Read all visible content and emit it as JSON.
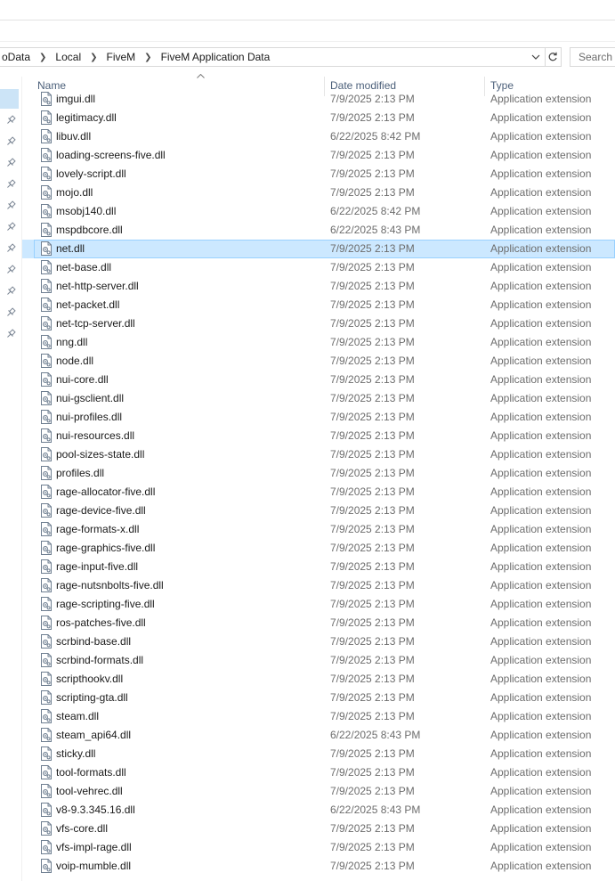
{
  "address": {
    "crumbs": [
      "oData",
      "Local",
      "FiveM",
      "FiveM Application Data"
    ],
    "search_placeholder": "Search F"
  },
  "columns": {
    "name": "Name",
    "date": "Date modified",
    "type": "Type"
  },
  "files": [
    {
      "name": "imgui.dll",
      "date": "7/9/2025 2:13 PM",
      "type": "Application extension"
    },
    {
      "name": "legitimacy.dll",
      "date": "7/9/2025 2:13 PM",
      "type": "Application extension"
    },
    {
      "name": "libuv.dll",
      "date": "6/22/2025 8:42 PM",
      "type": "Application extension"
    },
    {
      "name": "loading-screens-five.dll",
      "date": "7/9/2025 2:13 PM",
      "type": "Application extension"
    },
    {
      "name": "lovely-script.dll",
      "date": "7/9/2025 2:13 PM",
      "type": "Application extension"
    },
    {
      "name": "mojo.dll",
      "date": "7/9/2025 2:13 PM",
      "type": "Application extension"
    },
    {
      "name": "msobj140.dll",
      "date": "6/22/2025 8:42 PM",
      "type": "Application extension"
    },
    {
      "name": "mspdbcore.dll",
      "date": "6/22/2025 8:43 PM",
      "type": "Application extension"
    },
    {
      "name": "net.dll",
      "date": "7/9/2025 2:13 PM",
      "type": "Application extension",
      "selected": true
    },
    {
      "name": "net-base.dll",
      "date": "7/9/2025 2:13 PM",
      "type": "Application extension"
    },
    {
      "name": "net-http-server.dll",
      "date": "7/9/2025 2:13 PM",
      "type": "Application extension"
    },
    {
      "name": "net-packet.dll",
      "date": "7/9/2025 2:13 PM",
      "type": "Application extension"
    },
    {
      "name": "net-tcp-server.dll",
      "date": "7/9/2025 2:13 PM",
      "type": "Application extension"
    },
    {
      "name": "nng.dll",
      "date": "7/9/2025 2:13 PM",
      "type": "Application extension"
    },
    {
      "name": "node.dll",
      "date": "7/9/2025 2:13 PM",
      "type": "Application extension"
    },
    {
      "name": "nui-core.dll",
      "date": "7/9/2025 2:13 PM",
      "type": "Application extension"
    },
    {
      "name": "nui-gsclient.dll",
      "date": "7/9/2025 2:13 PM",
      "type": "Application extension"
    },
    {
      "name": "nui-profiles.dll",
      "date": "7/9/2025 2:13 PM",
      "type": "Application extension"
    },
    {
      "name": "nui-resources.dll",
      "date": "7/9/2025 2:13 PM",
      "type": "Application extension"
    },
    {
      "name": "pool-sizes-state.dll",
      "date": "7/9/2025 2:13 PM",
      "type": "Application extension"
    },
    {
      "name": "profiles.dll",
      "date": "7/9/2025 2:13 PM",
      "type": "Application extension"
    },
    {
      "name": "rage-allocator-five.dll",
      "date": "7/9/2025 2:13 PM",
      "type": "Application extension"
    },
    {
      "name": "rage-device-five.dll",
      "date": "7/9/2025 2:13 PM",
      "type": "Application extension"
    },
    {
      "name": "rage-formats-x.dll",
      "date": "7/9/2025 2:13 PM",
      "type": "Application extension"
    },
    {
      "name": "rage-graphics-five.dll",
      "date": "7/9/2025 2:13 PM",
      "type": "Application extension"
    },
    {
      "name": "rage-input-five.dll",
      "date": "7/9/2025 2:13 PM",
      "type": "Application extension"
    },
    {
      "name": "rage-nutsnbolts-five.dll",
      "date": "7/9/2025 2:13 PM",
      "type": "Application extension"
    },
    {
      "name": "rage-scripting-five.dll",
      "date": "7/9/2025 2:13 PM",
      "type": "Application extension"
    },
    {
      "name": "ros-patches-five.dll",
      "date": "7/9/2025 2:13 PM",
      "type": "Application extension"
    },
    {
      "name": "scrbind-base.dll",
      "date": "7/9/2025 2:13 PM",
      "type": "Application extension"
    },
    {
      "name": "scrbind-formats.dll",
      "date": "7/9/2025 2:13 PM",
      "type": "Application extension"
    },
    {
      "name": "scripthookv.dll",
      "date": "7/9/2025 2:13 PM",
      "type": "Application extension"
    },
    {
      "name": "scripting-gta.dll",
      "date": "7/9/2025 2:13 PM",
      "type": "Application extension"
    },
    {
      "name": "steam.dll",
      "date": "7/9/2025 2:13 PM",
      "type": "Application extension"
    },
    {
      "name": "steam_api64.dll",
      "date": "6/22/2025 8:43 PM",
      "type": "Application extension"
    },
    {
      "name": "sticky.dll",
      "date": "7/9/2025 2:13 PM",
      "type": "Application extension"
    },
    {
      "name": "tool-formats.dll",
      "date": "7/9/2025 2:13 PM",
      "type": "Application extension"
    },
    {
      "name": "tool-vehrec.dll",
      "date": "7/9/2025 2:13 PM",
      "type": "Application extension"
    },
    {
      "name": "v8-9.3.345.16.dll",
      "date": "6/22/2025 8:43 PM",
      "type": "Application extension"
    },
    {
      "name": "vfs-core.dll",
      "date": "7/9/2025 2:13 PM",
      "type": "Application extension"
    },
    {
      "name": "vfs-impl-rage.dll",
      "date": "7/9/2025 2:13 PM",
      "type": "Application extension"
    },
    {
      "name": "voip-mumble.dll",
      "date": "7/9/2025 2:13 PM",
      "type": "Application extension"
    }
  ],
  "colors": {
    "selection_bg": "#cce8ff",
    "selection_border": "#99d1ff",
    "header_text": "#4c607a",
    "secondary_text": "#6d6d6d"
  },
  "icons": {
    "file": "dll-file-icon",
    "pin": "pin-icon",
    "refresh": "refresh-icon",
    "dropdown": "chevron-down-icon",
    "sort": "sort-up-icon",
    "breadcrumb_separator": "chevron-right-icon"
  }
}
